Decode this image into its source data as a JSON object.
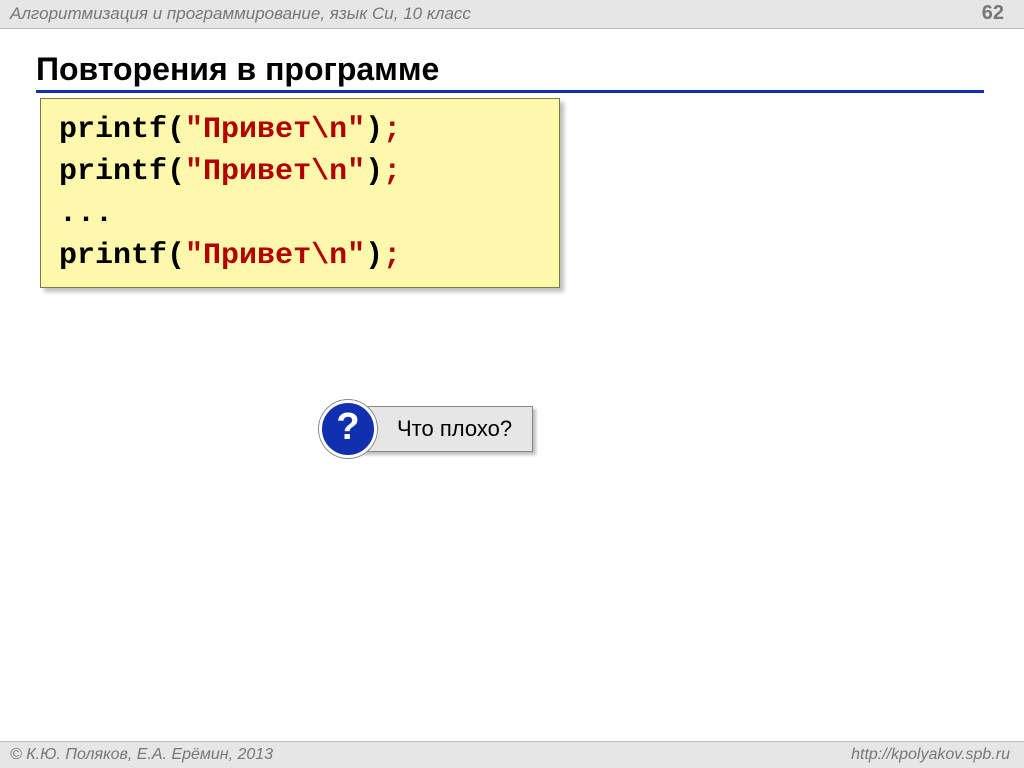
{
  "header": {
    "title": "Алгоритмизация и программирование, язык Си, 10 класс",
    "page_number": "62"
  },
  "slide": {
    "title": "Повторения в программе"
  },
  "code": {
    "lines": [
      {
        "fn": "printf",
        "open": "(",
        "str": "\"Привет\\n\"",
        "close": ")",
        "semi": ";"
      },
      {
        "fn": "printf",
        "open": "(",
        "str": "\"Привет\\n\"",
        "close": ")",
        "semi": ";"
      },
      {
        "dots": "..."
      },
      {
        "fn": "printf",
        "open": "(",
        "str": "\"Привет\\n\"",
        "close": ")",
        "semi": ";"
      }
    ]
  },
  "callout": {
    "icon": "?",
    "text": "Что плохо?"
  },
  "footer": {
    "left": "© К.Ю. Поляков, Е.А. Ерёмин, 2013",
    "right": "http://kpolyakov.spb.ru"
  }
}
